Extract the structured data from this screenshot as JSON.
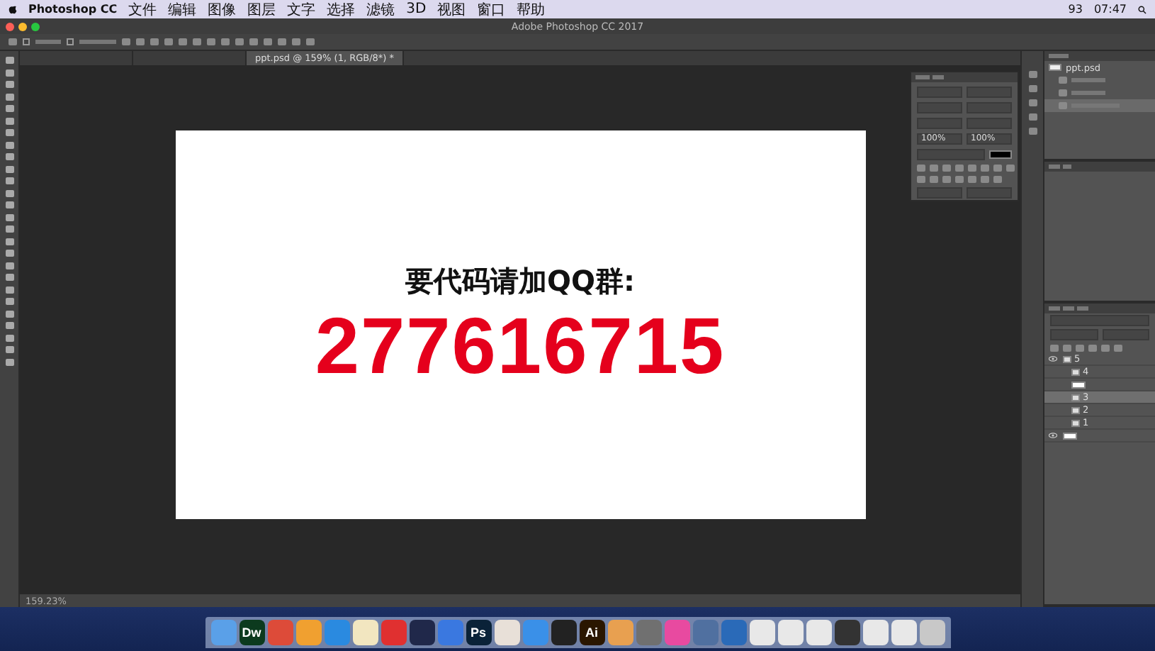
{
  "menu_bar": {
    "app": "Photoshop CC",
    "items": [
      "文件",
      "编辑",
      "图像",
      "图层",
      "文字",
      "选择",
      "滤镜",
      "3D",
      "视图",
      "窗口",
      "帮助"
    ],
    "battery": "93",
    "clock": "07:47"
  },
  "window": {
    "title": "Adobe Photoshop CC 2017"
  },
  "options_bar": {
    "auto_select": {
      "checked": false
    },
    "show_transform": {
      "checked": false
    }
  },
  "tabs": [
    {
      "selected": false
    },
    {
      "selected": false
    },
    {
      "label": "ppt.psd @ 159% (1, RGB/8*) *",
      "selected": true
    }
  ],
  "document": {
    "heading": "要代码请加QQ群:",
    "number": "277616715"
  },
  "character_panel": {
    "scale_v": "100%",
    "scale_h": "100%"
  },
  "history_panel": {
    "snapshot": "ppt.psd",
    "items": [
      {
        "selected": false
      },
      {
        "selected": false
      },
      {
        "selected": true
      }
    ]
  },
  "layers_panel": {
    "layers": [
      {
        "name": "5",
        "kind": "group",
        "visible": true,
        "selected": false,
        "children": [
          {
            "name": "4",
            "kind": "group",
            "visible": false,
            "selected": false
          },
          {
            "kind": "pixel",
            "visible": false,
            "selected": false
          },
          {
            "name": "3",
            "kind": "group",
            "visible": false,
            "selected": true
          },
          {
            "name": "2",
            "kind": "group",
            "visible": false,
            "selected": false
          },
          {
            "name": "1",
            "kind": "group",
            "visible": false,
            "selected": false
          }
        ]
      },
      {
        "kind": "pixel",
        "visible": true,
        "selected": false
      }
    ]
  },
  "status_bar": {
    "zoom": "159.23%"
  },
  "dock": [
    {
      "color": "#5aa0e8"
    },
    {
      "label": "Dw",
      "color": "#0c3a1e"
    },
    {
      "color": "#dd4b39"
    },
    {
      "color": "#f0a030"
    },
    {
      "color": "#2a8ae0"
    },
    {
      "color": "#f2e6c0"
    },
    {
      "color": "#e03030"
    },
    {
      "color": "#20284a"
    },
    {
      "color": "#3a78e0"
    },
    {
      "label": "Ps",
      "color": "#0a2238"
    },
    {
      "color": "#e8e0d8"
    },
    {
      "color": "#3a90e8"
    },
    {
      "color": "#222222"
    },
    {
      "label": "Ai",
      "color": "#2a1600"
    },
    {
      "color": "#e8a050"
    },
    {
      "color": "#707070"
    },
    {
      "color": "#e84aa0"
    },
    {
      "color": "#5070a0"
    },
    {
      "color": "#2a6ab8"
    },
    {
      "color": "#e8e8e8"
    },
    {
      "color": "#e8e8e8"
    },
    {
      "color": "#e8e8e8"
    },
    {
      "color": "#333333"
    },
    {
      "color": "#e8e8e8"
    },
    {
      "color": "#e8e8e8"
    },
    {
      "color": "#c8c8c8"
    }
  ]
}
